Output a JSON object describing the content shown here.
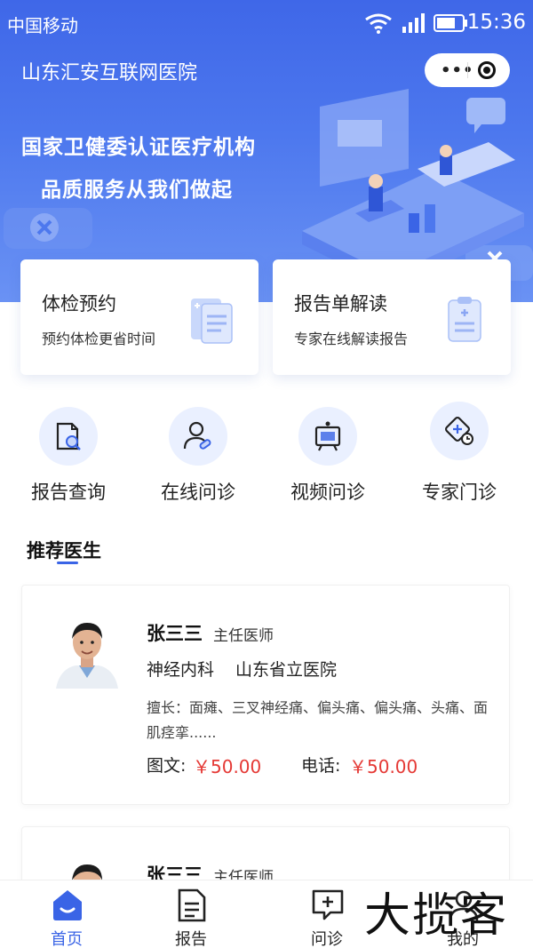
{
  "status_bar": {
    "carrier": "中国移动",
    "time": "15:36"
  },
  "titlebar": {
    "title": "山东汇安互联网医院"
  },
  "banner": {
    "line1": "国家卫健委认证医疗机构",
    "line2": "品质服务从我们做起"
  },
  "cards": [
    {
      "title": "体检预约",
      "subtitle": "预约体检更省时间"
    },
    {
      "title": "报告单解读",
      "subtitle": "专家在线解读报告"
    }
  ],
  "entries": [
    {
      "label": "报告查询",
      "icon": "report-search-icon"
    },
    {
      "label": "在线问诊",
      "icon": "online-consult-icon"
    },
    {
      "label": "视频问诊",
      "icon": "video-consult-icon"
    },
    {
      "label": "专家门诊",
      "icon": "expert-clinic-icon"
    }
  ],
  "section": {
    "title": "推荐医生"
  },
  "doctors": [
    {
      "name": "张三三",
      "title": "主任医师",
      "department": "神经内科",
      "hospital": "山东省立医院",
      "specialty": "擅长：面瘫、三叉神经痛、偏头痛、偏头痛、头痛、面肌痉挛......",
      "text_label": "图文:",
      "text_price": "￥50.00",
      "phone_label": "电话:",
      "phone_price": "￥50.00"
    },
    {
      "name": "张三三",
      "title": "主任医师"
    }
  ],
  "tabbar": [
    {
      "label": "首页",
      "icon": "home-icon",
      "active": true
    },
    {
      "label": "报告",
      "icon": "report-icon",
      "active": false
    },
    {
      "label": "问诊",
      "icon": "consult-icon",
      "active": false
    },
    {
      "label": "我的",
      "icon": "profile-icon",
      "active": false
    }
  ],
  "watermark": "大揽客",
  "colors": {
    "primary": "#3a64e6",
    "price": "#e53935",
    "banner_top": "#3f67e8"
  }
}
